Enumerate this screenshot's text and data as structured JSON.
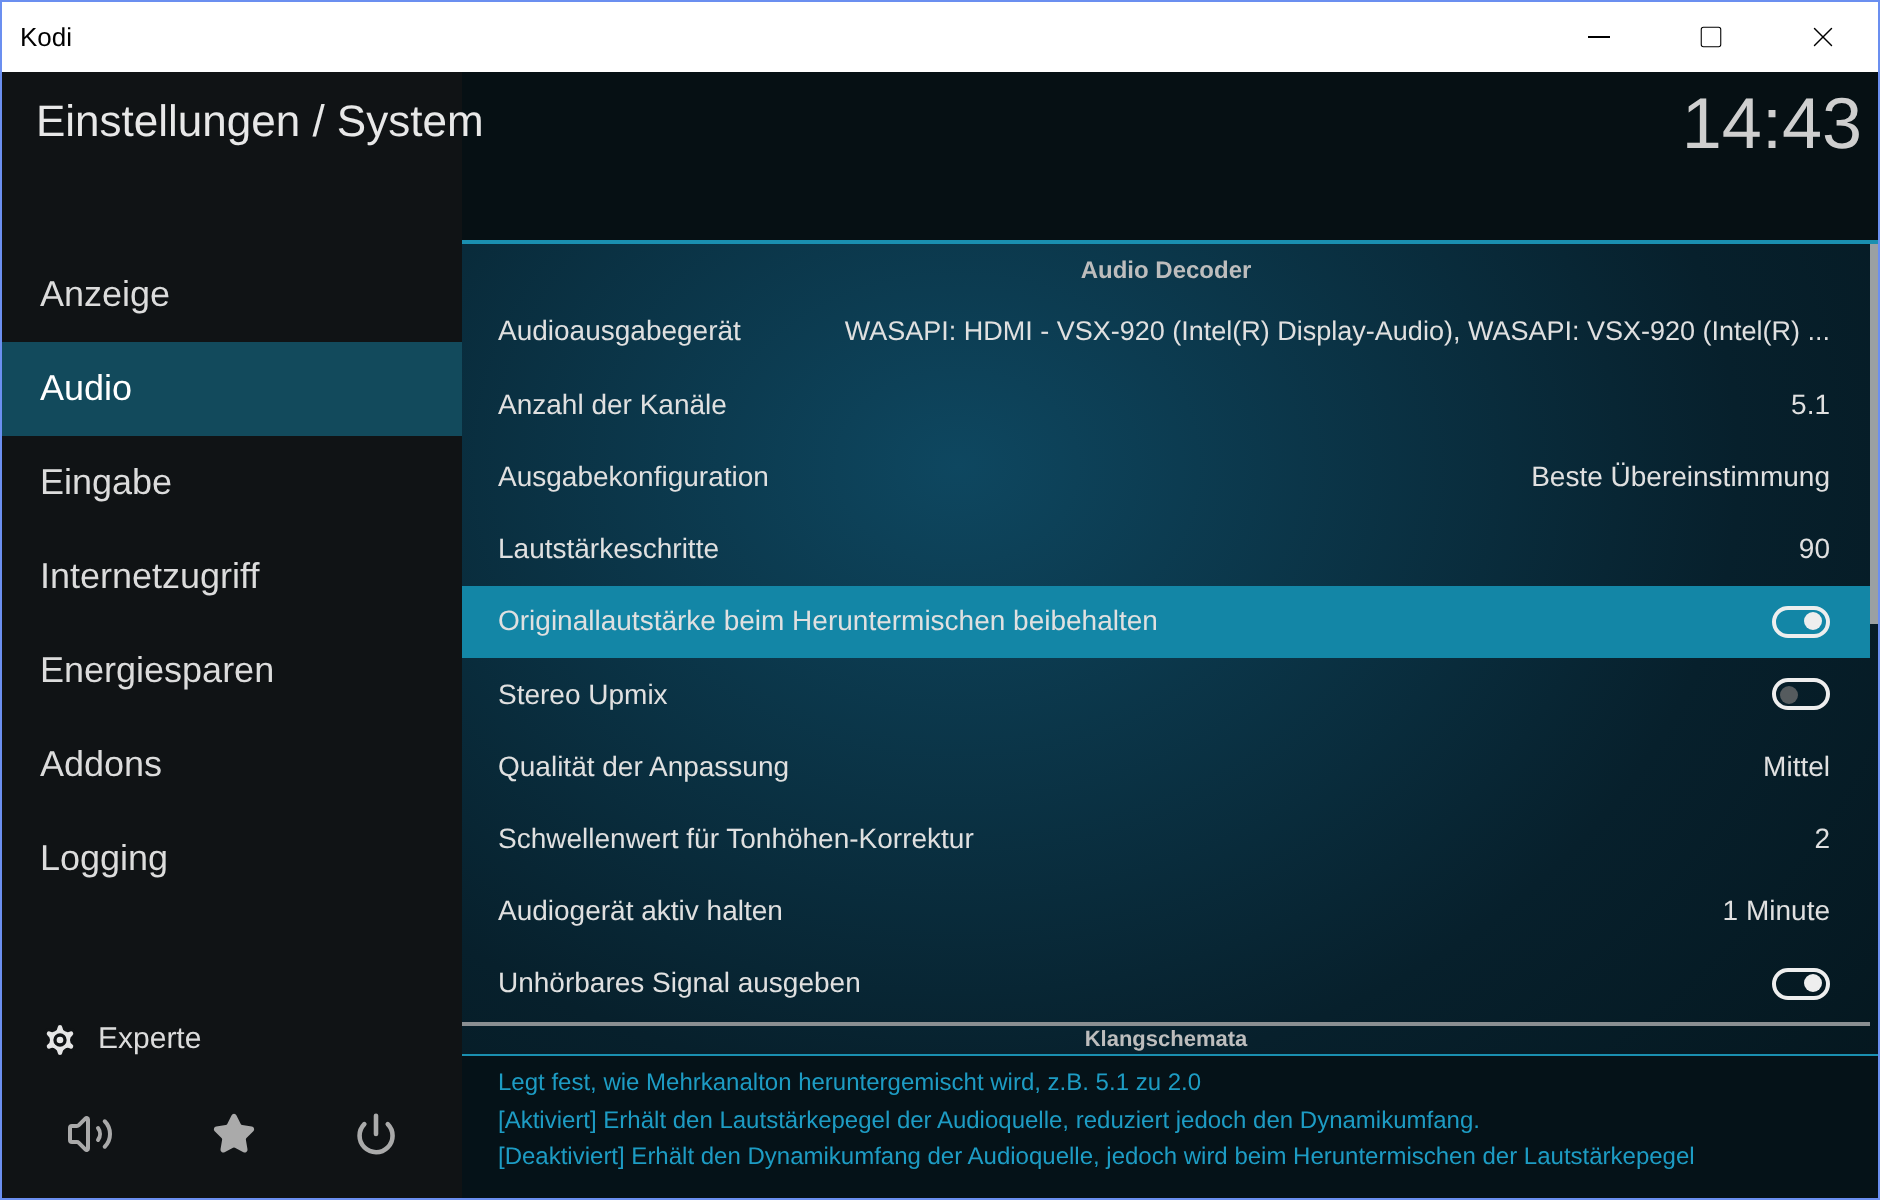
{
  "window": {
    "title": "Kodi"
  },
  "header": {
    "title": "Einstellungen / System",
    "clock": "14:43"
  },
  "sidebar": {
    "items": [
      {
        "label": "Anzeige",
        "selected": false
      },
      {
        "label": "Audio",
        "selected": true
      },
      {
        "label": "Eingabe",
        "selected": false
      },
      {
        "label": "Internetzugriff",
        "selected": false
      },
      {
        "label": "Energiesparen",
        "selected": false
      },
      {
        "label": "Addons",
        "selected": false
      },
      {
        "label": "Logging",
        "selected": false
      }
    ],
    "level_button": {
      "label": "Experte"
    }
  },
  "settings": {
    "section": "Audio Decoder",
    "rows": [
      {
        "kind": "list",
        "label": "Audioausgabegerät",
        "value": "WASAPI: HDMI - VSX-920 (Intel(R) Display-Audio), WASAPI: VSX-920 (Intel(R) ...",
        "selected": false
      },
      {
        "kind": "list",
        "label": "Anzahl der Kanäle",
        "value": "5.1",
        "selected": false
      },
      {
        "kind": "list",
        "label": "Ausgabekonfiguration",
        "value": "Beste Übereinstimmung",
        "selected": false
      },
      {
        "kind": "list",
        "label": "Lautstärkeschritte",
        "value": "90",
        "selected": false
      },
      {
        "kind": "toggle",
        "label": "Originallautstärke beim Heruntermischen beibehalten",
        "on": true,
        "selected": true
      },
      {
        "kind": "toggle",
        "label": "Stereo Upmix",
        "on": false,
        "selected": false
      },
      {
        "kind": "list",
        "label": "Qualität der Anpassung",
        "value": "Mittel",
        "selected": false
      },
      {
        "kind": "list",
        "label": "Schwellenwert für Tonhöhen-Korrektur",
        "value": "2",
        "selected": false
      },
      {
        "kind": "list",
        "label": "Audiogerät aktiv halten",
        "value": "1 Minute",
        "selected": false
      },
      {
        "kind": "toggle",
        "label": "Unhörbares Signal ausgeben",
        "on": true,
        "selected": false
      }
    ],
    "next_section": "Klangschemata"
  },
  "description": [
    "Legt fest, wie Mehrkanalton heruntergemischt wird, z.B. 5.1 zu 2.0",
    "[Aktiviert] Erhält den Lautstärkepegel der Audioquelle, reduziert jedoch den Dynamikumfang.",
    "[Deaktiviert] Erhält den Dynamikumfang der Audioquelle, jedoch wird beim Heruntermischen der Lautstärkepegel"
  ]
}
